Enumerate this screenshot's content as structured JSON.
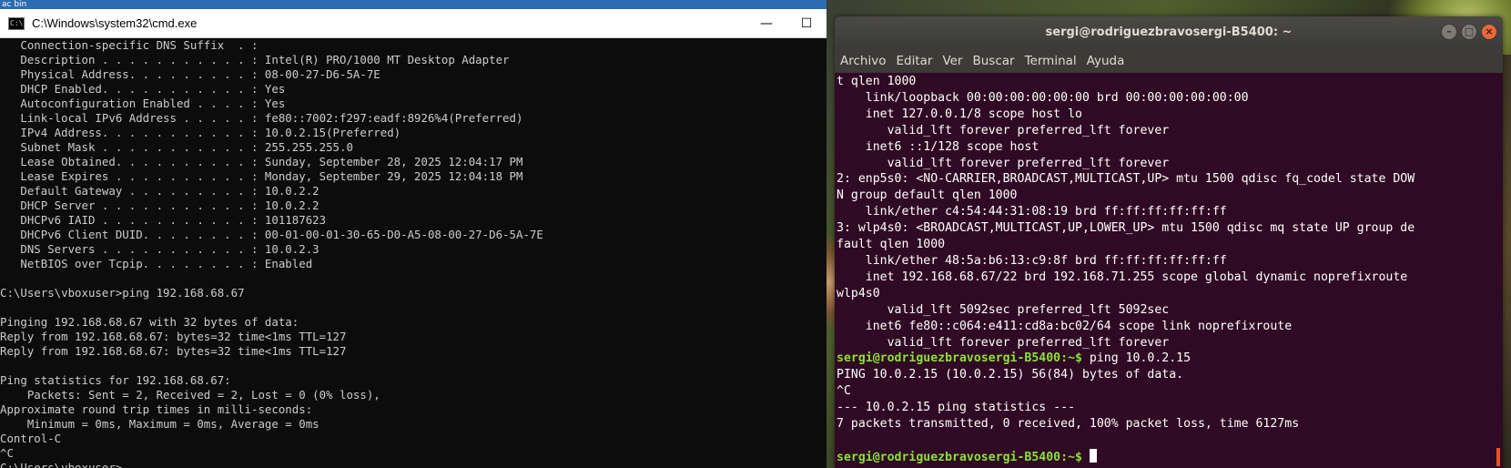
{
  "windows": {
    "top_strip_text": "ac bin",
    "title": "C:\\Windows\\system32\\cmd.exe",
    "controls": {
      "minimize": "—",
      "maximize": "☐"
    },
    "console_lines": [
      "   Connection-specific DNS Suffix  . :",
      "   Description . . . . . . . . . . . : Intel(R) PRO/1000 MT Desktop Adapter",
      "   Physical Address. . . . . . . . . : 08-00-27-D6-5A-7E",
      "   DHCP Enabled. . . . . . . . . . . : Yes",
      "   Autoconfiguration Enabled . . . . : Yes",
      "   Link-local IPv6 Address . . . . . : fe80::7002:f297:eadf:8926%4(Preferred)",
      "   IPv4 Address. . . . . . . . . . . : 10.0.2.15(Preferred)",
      "   Subnet Mask . . . . . . . . . . . : 255.255.255.0",
      "   Lease Obtained. . . . . . . . . . : Sunday, September 28, 2025 12:04:17 PM",
      "   Lease Expires . . . . . . . . . . : Monday, September 29, 2025 12:04:18 PM",
      "   Default Gateway . . . . . . . . . : 10.0.2.2",
      "   DHCP Server . . . . . . . . . . . : 10.0.2.2",
      "   DHCPv6 IAID . . . . . . . . . . . : 101187623",
      "   DHCPv6 Client DUID. . . . . . . . : 00-01-00-01-30-65-D0-A5-08-00-27-D6-5A-7E",
      "   DNS Servers . . . . . . . . . . . : 10.0.2.3",
      "   NetBIOS over Tcpip. . . . . . . . : Enabled",
      "",
      "C:\\Users\\vboxuser>ping 192.168.68.67",
      "",
      "Pinging 192.168.68.67 with 32 bytes of data:",
      "Reply from 192.168.68.67: bytes=32 time<1ms TTL=127",
      "Reply from 192.168.68.67: bytes=32 time<1ms TTL=127",
      "",
      "Ping statistics for 192.168.68.67:",
      "    Packets: Sent = 2, Received = 2, Lost = 0 (0% loss),",
      "Approximate round trip times in milli-seconds:",
      "    Minimum = 0ms, Maximum = 0ms, Average = 0ms",
      "Control-C",
      "^C",
      "C:\\Users\\vboxuser>"
    ]
  },
  "ubuntu": {
    "title": "sergi@rodriguezbravosergi-B5400: ~",
    "buttons": {
      "minimize": "–",
      "maximize": "□",
      "close": "×"
    },
    "menu": [
      "Archivo",
      "Editar",
      "Ver",
      "Buscar",
      "Terminal",
      "Ayuda"
    ],
    "prompt": "sergi@rodriguezbravosergi-B5400:~$",
    "lines": [
      {
        "t": "t qlen 1000"
      },
      {
        "t": "    link/loopback 00:00:00:00:00:00 brd 00:00:00:00:00:00"
      },
      {
        "t": "    inet 127.0.0.1/8 scope host lo"
      },
      {
        "t": "       valid_lft forever preferred_lft forever"
      },
      {
        "t": "    inet6 ::1/128 scope host"
      },
      {
        "t": "       valid_lft forever preferred_lft forever"
      },
      {
        "t": "2: enp5s0: <NO-CARRIER,BROADCAST,MULTICAST,UP> mtu 1500 qdisc fq_codel state DOW"
      },
      {
        "t": "N group default qlen 1000"
      },
      {
        "t": "    link/ether c4:54:44:31:08:19 brd ff:ff:ff:ff:ff:ff"
      },
      {
        "t": "3: wlp4s0: <BROADCAST,MULTICAST,UP,LOWER_UP> mtu 1500 qdisc mq state UP group de"
      },
      {
        "t": "fault qlen 1000"
      },
      {
        "t": "    link/ether 48:5a:b6:13:c9:8f brd ff:ff:ff:ff:ff:ff"
      },
      {
        "t": "    inet 192.168.68.67/22 brd 192.168.71.255 scope global dynamic noprefixroute"
      },
      {
        "t": "wlp4s0"
      },
      {
        "t": "       valid_lft 5092sec preferred_lft 5092sec"
      },
      {
        "t": "    inet6 fe80::c064:e411:cd8a:bc02/64 scope link noprefixroute"
      },
      {
        "t": "       valid_lft forever preferred_lft forever"
      },
      {
        "p": true,
        "t": " ping 10.0.2.15"
      },
      {
        "t": "PING 10.0.2.15 (10.0.2.15) 56(84) bytes of data."
      },
      {
        "t": "^C"
      },
      {
        "t": "--- 10.0.2.15 ping statistics ---"
      },
      {
        "t": "7 packets transmitted, 0 received, 100% packet loss, time 6127ms"
      },
      {
        "t": ""
      },
      {
        "p": true,
        "t": " ",
        "cursor": true
      }
    ]
  }
}
